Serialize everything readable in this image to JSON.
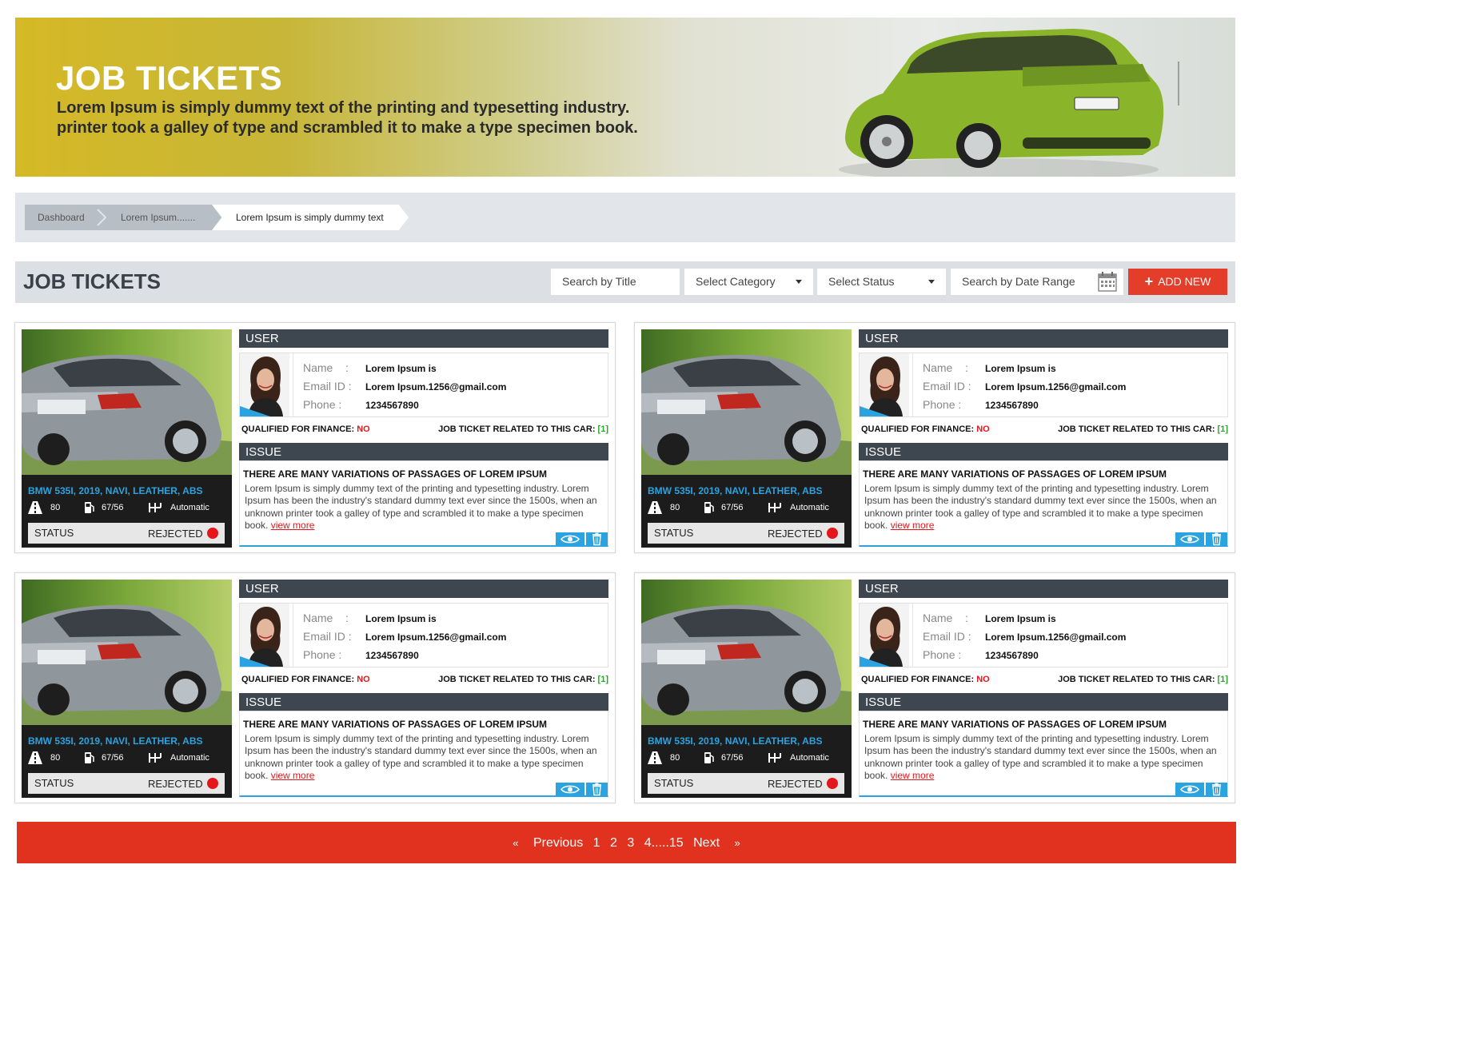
{
  "hero": {
    "title": "JOB TICKETS",
    "line1": "Lorem Ipsum is simply dummy text of the printing and typesetting industry.",
    "line2": "printer took a galley of type and scrambled it to make a type specimen book."
  },
  "breadcrumb": [
    "Dashboard",
    "Lorem Ipsum.......",
    "Lorem Ipsum is simply dummy text"
  ],
  "toolbar": {
    "title": "JOB TICKETS",
    "search_title_placeholder": "Search by Title",
    "category_placeholder": "Select Category",
    "status_placeholder": "Select Status",
    "date_placeholder": "Search by Date Range",
    "add_label": "ADD NEW"
  },
  "tickets": [
    {
      "model": "BMW 535I, 2019, NAVI, LEATHER, ABS",
      "spec_mileage": "80",
      "spec_fuel": "67/56",
      "spec_transmission": "Automatic",
      "status_label": "STATUS",
      "status_value": "REJECTED",
      "user_head": "USER",
      "name_key": "Name",
      "name_colon": ":",
      "name_value": "Lorem Ipsum is",
      "email_key": "Email ID :",
      "email_value": "Lorem Ipsum.1256@gmail.com",
      "phone_key": "Phone :",
      "phone_value": "1234567890",
      "finance_label": "QUALIFIED FOR FINANCE:",
      "finance_value": "NO",
      "related_label": "JOB TICKET RELATED TO THIS CAR:",
      "related_value": "[1]",
      "issue_head": "ISSUE",
      "issue_title": "THERE ARE MANY VARIATIONS OF PASSAGES OF LOREM IPSUM",
      "issue_text": "Lorem Ipsum is simply dummy text of the printing and typesetting industry. Lorem Ipsum has been the industry's standard dummy text ever since the 1500s, when an unknown printer took a galley of type and scrambled it to make a type specimen book.",
      "view_more": "view more"
    },
    {
      "model": "BMW 535I, 2019, NAVI, LEATHER, ABS",
      "spec_mileage": "80",
      "spec_fuel": "67/56",
      "spec_transmission": "Automatic",
      "status_label": "STATUS",
      "status_value": "REJECTED",
      "user_head": "USER",
      "name_key": "Name",
      "name_colon": ":",
      "name_value": "Lorem Ipsum is",
      "email_key": "Email ID :",
      "email_value": "Lorem Ipsum.1256@gmail.com",
      "phone_key": "Phone :",
      "phone_value": "1234567890",
      "finance_label": "QUALIFIED FOR FINANCE:",
      "finance_value": "NO",
      "related_label": "JOB TICKET RELATED TO THIS CAR:",
      "related_value": "[1]",
      "issue_head": "ISSUE",
      "issue_title": "THERE ARE MANY VARIATIONS OF PASSAGES OF LOREM IPSUM",
      "issue_text": "Lorem Ipsum is simply dummy text of the printing and typesetting industry. Lorem Ipsum has been the industry's standard dummy text ever since the 1500s, when an unknown printer took a galley of type and scrambled it to make a type specimen book.",
      "view_more": "view more"
    },
    {
      "model": "BMW 535I, 2019, NAVI, LEATHER, ABS",
      "spec_mileage": "80",
      "spec_fuel": "67/56",
      "spec_transmission": "Automatic",
      "status_label": "STATUS",
      "status_value": "REJECTED",
      "user_head": "USER",
      "name_key": "Name",
      "name_colon": ":",
      "name_value": "Lorem Ipsum is",
      "email_key": "Email ID :",
      "email_value": "Lorem Ipsum.1256@gmail.com",
      "phone_key": "Phone :",
      "phone_value": "1234567890",
      "finance_label": "QUALIFIED FOR FINANCE:",
      "finance_value": "NO",
      "related_label": "JOB TICKET RELATED TO THIS CAR:",
      "related_value": "[1]",
      "issue_head": "ISSUE",
      "issue_title": "THERE ARE MANY VARIATIONS OF PASSAGES OF LOREM IPSUM",
      "issue_text": "Lorem Ipsum is simply dummy text of the printing and typesetting industry. Lorem Ipsum has been the industry's standard dummy text ever since the 1500s, when an unknown printer took a galley of type and scrambled it to make a type specimen book.",
      "view_more": "view more"
    },
    {
      "model": "BMW 535I, 2019, NAVI, LEATHER, ABS",
      "spec_mileage": "80",
      "spec_fuel": "67/56",
      "spec_transmission": "Automatic",
      "status_label": "STATUS",
      "status_value": "REJECTED",
      "user_head": "USER",
      "name_key": "Name",
      "name_colon": ":",
      "name_value": "Lorem Ipsum is",
      "email_key": "Email ID :",
      "email_value": "Lorem Ipsum.1256@gmail.com",
      "phone_key": "Phone :",
      "phone_value": "1234567890",
      "finance_label": "QUALIFIED FOR FINANCE:",
      "finance_value": "NO",
      "related_label": "JOB TICKET RELATED TO THIS CAR:",
      "related_value": "[1]",
      "issue_head": "ISSUE",
      "issue_title": "THERE ARE MANY VARIATIONS OF PASSAGES OF LOREM IPSUM",
      "issue_text": "Lorem Ipsum is simply dummy text of the printing and typesetting industry. Lorem Ipsum has been the industry's standard dummy text ever since the 1500s, when an unknown printer took a galley of type and scrambled it to make a type specimen book.",
      "view_more": "view more"
    }
  ],
  "pagination": {
    "first": "«",
    "previous": "Previous",
    "pages": [
      "1",
      "2",
      "3",
      "4.....15"
    ],
    "next": "Next",
    "last": "»"
  },
  "colors": {
    "accent_red": "#e43d2a",
    "status_red": "#e4161b",
    "link_blue": "#2ba3e0",
    "header_dark": "#3e4650",
    "finance_green": "#2ba52b"
  }
}
